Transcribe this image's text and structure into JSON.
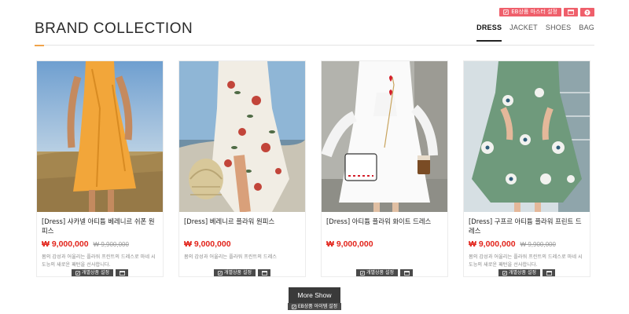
{
  "admin": {
    "master_label": "EB상품 마스터 설정",
    "item_label": "개별상품 설정",
    "more_label": "EB상품 아이템 설정"
  },
  "header": {
    "title": "BRAND COLLECTION",
    "tabs": [
      {
        "label": "DRESS",
        "active": true
      },
      {
        "label": "JACKET",
        "active": false
      },
      {
        "label": "SHOES",
        "active": false
      },
      {
        "label": "BAG",
        "active": false
      }
    ]
  },
  "products": [
    {
      "name": "[Dress] 샤카넬 아티튬 베레니르 쉬폰 원피스",
      "price": "₩ 9,000,000",
      "old_price": "₩ 9,900,000",
      "desc": "봄의 감성과 어울리는 플라워 프린트의 드레스로 마네 시도능의 새로운 패턴을 선사합니다."
    },
    {
      "name": "[Dress] 베레니르 플라워 원피스",
      "price": "₩ 9,000,000",
      "old_price": "",
      "desc": "봄의 감성과 어울리는 플라워 프린트의 드레스"
    },
    {
      "name": "[Dress] 아티튬 플라워 화이트 드레스",
      "price": "₩ 9,000,000",
      "old_price": "",
      "desc": ""
    },
    {
      "name": "[Dress] 구프르 아티튬 플라워 프린트 드레스",
      "price": "₩ 9,000,000",
      "old_price": "₩ 9,900,000",
      "desc": "봄의 감성과 어울리는 플라워 프린트의 드레스로 마네 시도능의 새로운 패턴을 선사합니다."
    }
  ],
  "more_button": "More Show",
  "colors": {
    "admin_pink": "#ef5f6b",
    "price_red": "#e2231a",
    "accent_orange": "#f0a44b"
  }
}
